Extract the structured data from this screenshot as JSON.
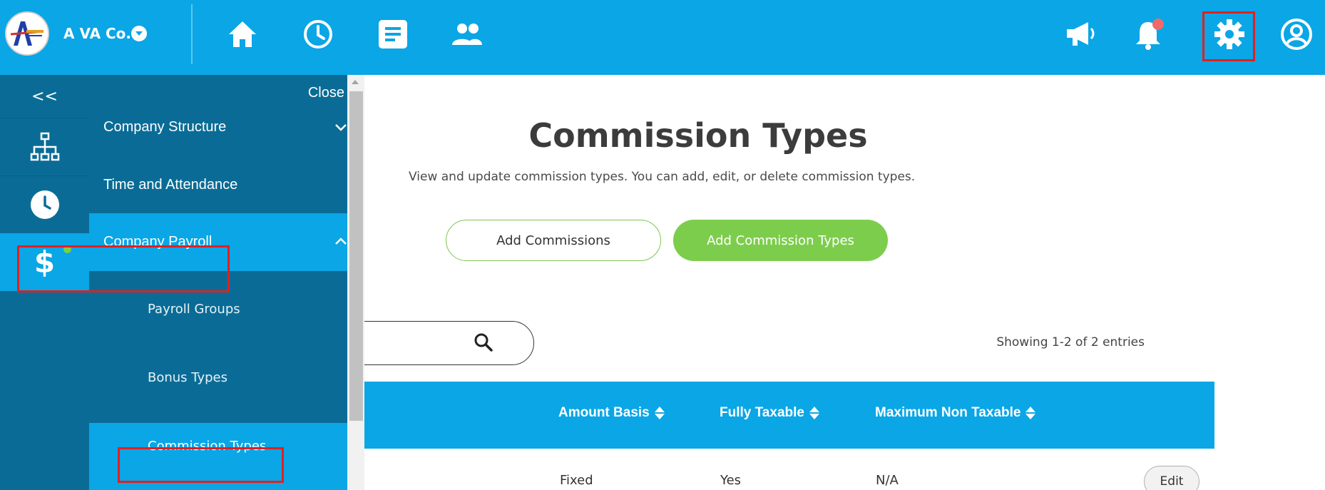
{
  "header": {
    "company_name": "A VA Co.",
    "nav_icons": [
      "home-icon",
      "clock-icon",
      "document-icon",
      "people-icon"
    ],
    "right_icons": [
      "megaphone-icon",
      "bell-icon",
      "gear-icon",
      "user-icon"
    ],
    "accent_color": "#0aa6e6",
    "notification_dot_color": "#f06a6a"
  },
  "rail": {
    "collapse_label": "<<",
    "icons": [
      "org-structure-icon",
      "clock-icon",
      "dollar-icon"
    ],
    "active_dot_color": "#7dcd4c"
  },
  "menu": {
    "close_label": "Close",
    "items": [
      {
        "label": "Company Structure"
      },
      {
        "label": "Time and Attendance"
      },
      {
        "label": "Company Payroll"
      }
    ],
    "payroll_sub_items": [
      {
        "label": "Payroll Groups"
      },
      {
        "label": "Bonus Types"
      },
      {
        "label": "Commission Types"
      }
    ]
  },
  "main": {
    "title": "Commission Types",
    "description": "View and update commission types. You can add, edit, or delete commission types.",
    "add_commissions_label": "Add Commissions",
    "add_commission_types_label": "Add Commission Types",
    "search_placeholder": "",
    "entries_text": "Showing 1-2 of 2 entries",
    "table": {
      "columns": [
        "Amount Basis",
        "Fully Taxable",
        "Maximum Non Taxable"
      ],
      "rows": [
        {
          "amount_basis": "Fixed",
          "fully_taxable": "Yes",
          "max_non_taxable": "N/A",
          "action": "Edit"
        }
      ]
    }
  }
}
